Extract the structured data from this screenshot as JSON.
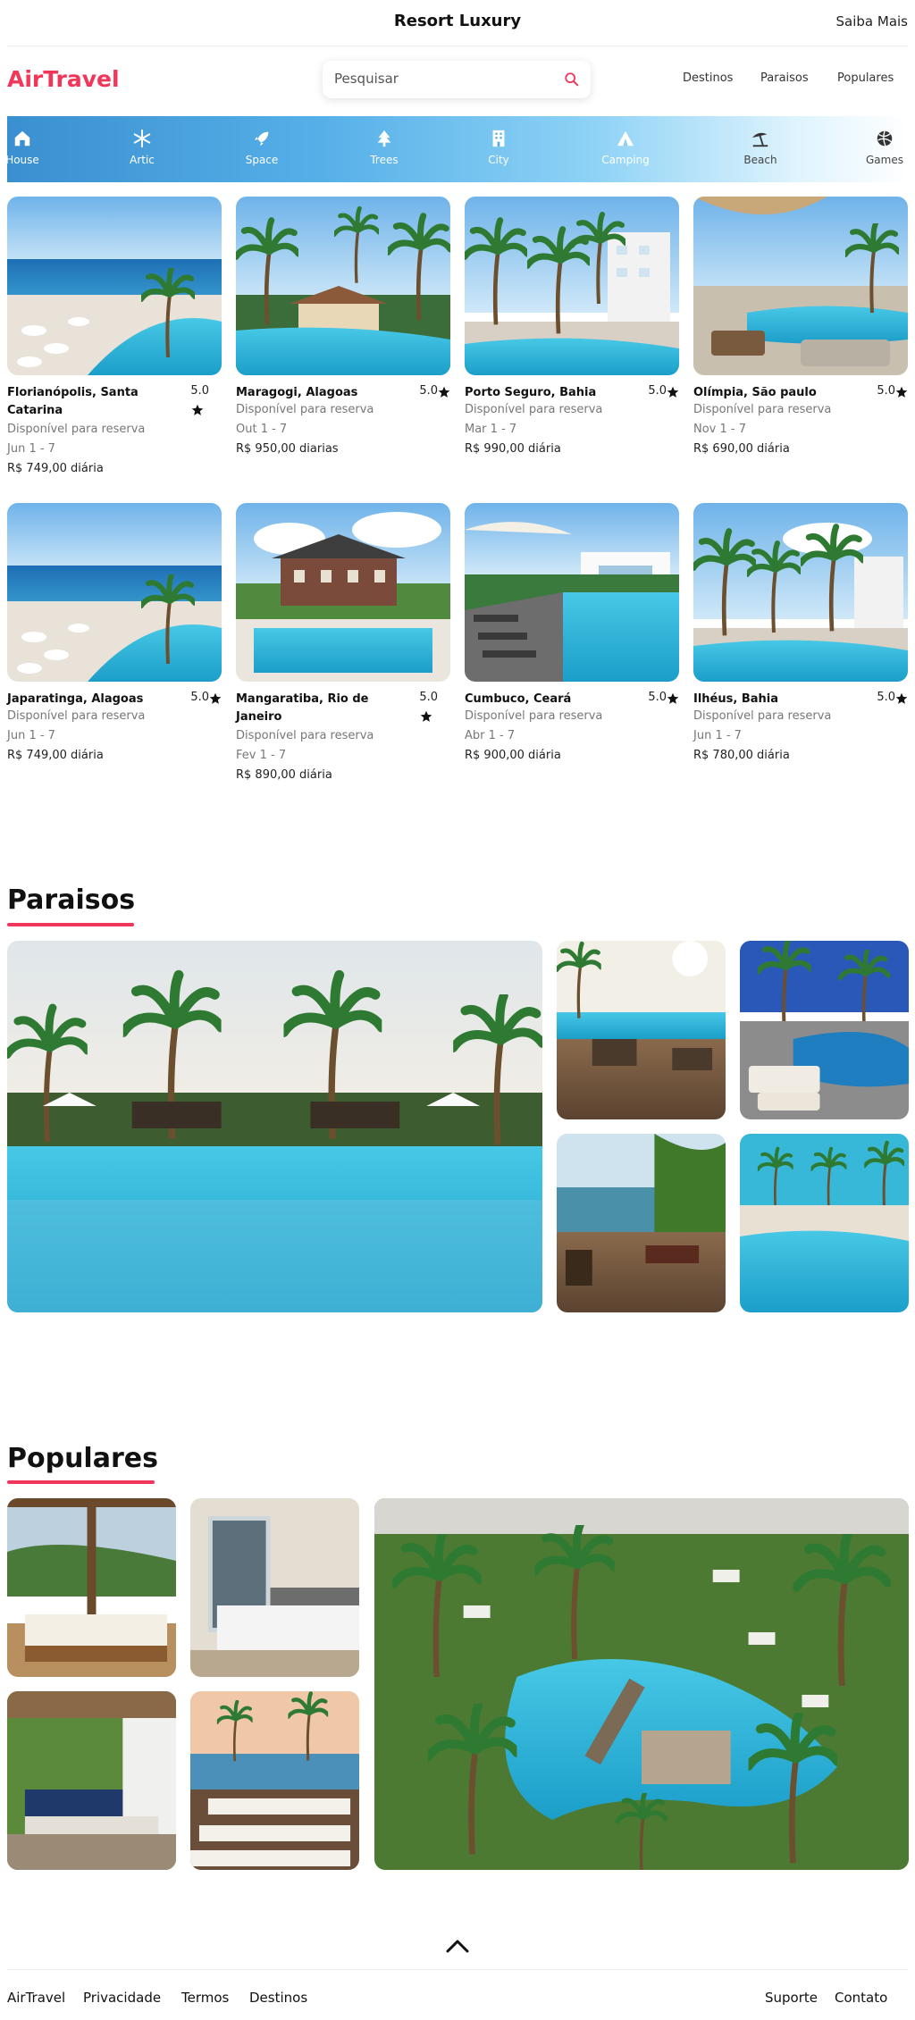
{
  "header": {
    "title": "Resort Luxury",
    "more_link": "Saiba Mais"
  },
  "brand": {
    "logo": "AirTravel",
    "accent": "#f0375a"
  },
  "search": {
    "placeholder": "Pesquisar",
    "icon": "search-icon"
  },
  "nav": [
    "Destinos",
    "Paraisos",
    "Populares"
  ],
  "categories": [
    {
      "label": "House",
      "icon": "house-icon"
    },
    {
      "label": "Artic",
      "icon": "snowflake-icon"
    },
    {
      "label": "Space",
      "icon": "rocket-icon"
    },
    {
      "label": "Trees",
      "icon": "tree-icon"
    },
    {
      "label": "City",
      "icon": "building-icon"
    },
    {
      "label": "Camping",
      "icon": "tent-icon"
    },
    {
      "label": "Beach",
      "icon": "umbrella-beach-icon"
    },
    {
      "label": "Games",
      "icon": "ball-icon"
    }
  ],
  "listings": [
    {
      "name": "Florianópolis, Santa Catarina",
      "rating": "5.0",
      "availability": "Disponível para reserva",
      "dates": "Jun 1 - 7",
      "price": "R$ 749,00 diária"
    },
    {
      "name": "Maragogi, Alagoas",
      "rating": "5.0",
      "availability": "Disponível para reserva",
      "dates": "Out 1 - 7",
      "price": "R$ 950,00 diarias"
    },
    {
      "name": "Porto Seguro, Bahia",
      "rating": "5.0",
      "availability": "Disponível para reserva",
      "dates": "Mar 1 - 7",
      "price": "R$ 990,00 diária"
    },
    {
      "name": "Olímpia, São paulo",
      "rating": "5.0",
      "availability": "Disponível para reserva",
      "dates": "Nov 1 - 7",
      "price": "R$ 690,00 diária"
    },
    {
      "name": "Japaratinga, Alagoas",
      "rating": "5.0",
      "availability": "Disponível para reserva",
      "dates": "Jun 1 - 7",
      "price": "R$ 749,00 diária"
    },
    {
      "name": "Mangaratiba, Rio de Janeiro",
      "rating": "5.0",
      "availability": "Disponível para reserva",
      "dates": "Fev 1 - 7",
      "price": "R$ 890,00 diária"
    },
    {
      "name": "Cumbuco, Ceará",
      "rating": "5.0",
      "availability": "Disponível para reserva",
      "dates": "Abr 1 - 7",
      "price": "R$ 900,00 diária"
    },
    {
      "name": "Ilhéus, Bahia",
      "rating": "5.0",
      "availability": "Disponível para reserva",
      "dates": "Jun 1 - 7",
      "price": "R$ 780,00 diária"
    }
  ],
  "sections": {
    "paraisos": "Paraisos",
    "populares": "Populares"
  },
  "back_to_top_icon": "chevron-up-icon",
  "footer": {
    "left": [
      "AirTravel",
      "Privacidade",
      "Termos",
      "Destinos"
    ],
    "right": [
      "Suporte",
      "Contato"
    ]
  }
}
